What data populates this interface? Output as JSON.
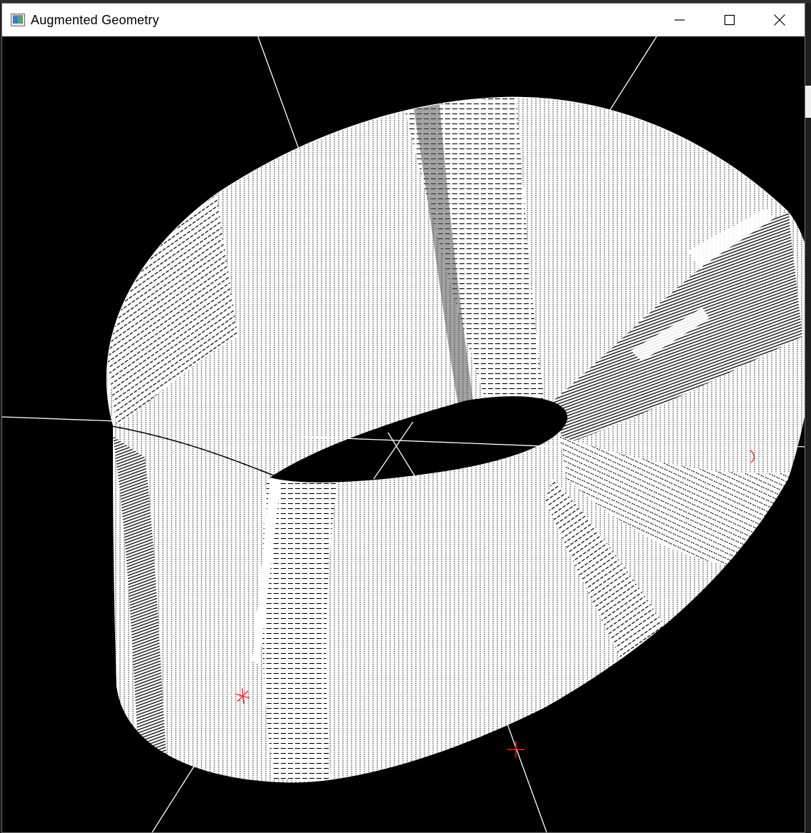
{
  "window": {
    "title": "Augmented Geometry",
    "icon": "app-window-icon",
    "controls": [
      "minimize-icon",
      "maximize-icon",
      "close-icon"
    ]
  },
  "scene": {
    "object": "mobius-strip wireframe",
    "background_color": "#000000",
    "mesh_color": "#ffffff",
    "axis_color": "#ffffff",
    "marker_color": "#ff2020",
    "markers": [
      "red-cross-marker",
      "red-cross-marker",
      "red-tick-marker"
    ]
  }
}
